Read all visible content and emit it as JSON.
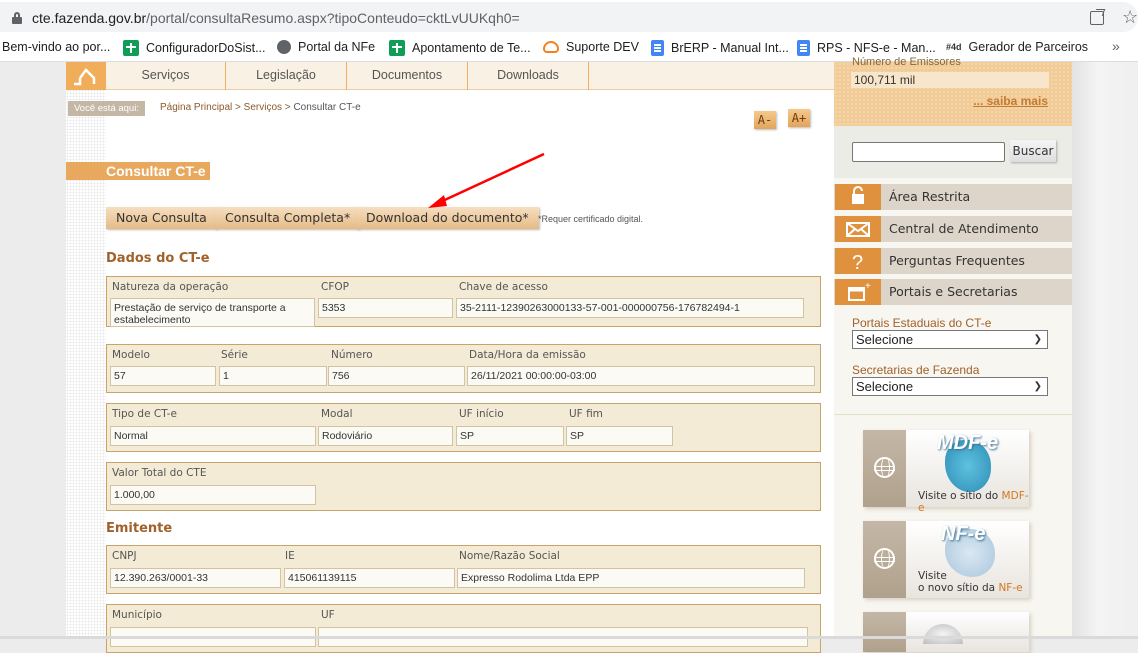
{
  "browser": {
    "url_host": "cte.fazenda.gov.br",
    "url_path": "/portal/consultaResumo.aspx?tipoConteudo=cktLvUUKqh0=",
    "bookmarks": [
      {
        "label": "Bem-vindo ao por...",
        "icon": "none"
      },
      {
        "label": "ConfiguradorDoSist...",
        "icon": "green-plus-icon"
      },
      {
        "label": "Portal da NFe",
        "icon": "globe-icon"
      },
      {
        "label": "Apontamento de Te...",
        "icon": "green-plus-icon"
      },
      {
        "label": "Suporte DEV",
        "icon": "cloud-icon"
      },
      {
        "label": "BrERP - Manual Int...",
        "icon": "doc-icon"
      },
      {
        "label": "RPS - NFS-e - Man...",
        "icon": "doc-icon"
      },
      {
        "label": "Gerador de Parceiros",
        "icon": "4d-icon",
        "icon_text": "#4d"
      }
    ],
    "more_bookmarks": "»"
  },
  "nav": {
    "items": [
      "Serviços",
      "Legislação",
      "Documentos",
      "Downloads"
    ]
  },
  "breadcrumb": {
    "label": "Você está aqui:",
    "items": [
      "Página Principal",
      "Serviços",
      "Consultar CT-e"
    ],
    "separator": " > "
  },
  "font_controls": {
    "decrease": "A-",
    "increase": "A+"
  },
  "page_title": "Consultar CT-e",
  "actions": {
    "new_query": "Nova Consulta",
    "full_query": "Consulta Completa*",
    "download": "Download do documento*",
    "note": "*Requer certificado digital."
  },
  "dados": {
    "heading": "Dados do CT-e",
    "row1": {
      "natureza_label": "Natureza da operação",
      "natureza_value": "Prestação de serviço de transporte a estabelecimento",
      "cfop_label": "CFOP",
      "cfop_value": "5353",
      "chave_label": "Chave de acesso",
      "chave_value": "35-2111-12390263000133-57-001-000000756-176782494-1"
    },
    "row2": {
      "modelo_label": "Modelo",
      "modelo_value": "57",
      "serie_label": "Série",
      "serie_value": "1",
      "numero_label": "Número",
      "numero_value": "756",
      "data_label": "Data/Hora da emissão",
      "data_value": "26/11/2021 00:00:00-03:00"
    },
    "row3": {
      "tipo_label": "Tipo de CT-e",
      "tipo_value": "Normal",
      "modal_label": "Modal",
      "modal_value": "Rodoviário",
      "ufini_label": "UF início",
      "ufini_value": "SP",
      "uffim_label": "UF fim",
      "uffim_value": "SP"
    },
    "row4": {
      "valor_label": "Valor Total do CTE",
      "valor_value": "1.000,00"
    }
  },
  "emitente": {
    "heading": "Emitente",
    "row1": {
      "cnpj_label": "CNPJ",
      "cnpj_value": "12.390.263/0001-33",
      "ie_label": "IE",
      "ie_value": "415061139115",
      "nome_label": "Nome/Razão Social",
      "nome_value": "Expresso Rodolima Ltda EPP"
    },
    "row2": {
      "municipio_label": "Município",
      "municipio_value": "",
      "uf_label": "UF",
      "uf_value": ""
    }
  },
  "sidebar": {
    "emitters_label": "Número de Emissores",
    "emitters_value": "100,711 mil",
    "saiba_mais": "... saiba mais",
    "search_placeholder": "",
    "search_button": "Buscar",
    "menu": [
      {
        "label": "Área Restrita",
        "icon": "lock-icon"
      },
      {
        "label": "Central de Atendimento",
        "icon": "envelope-icon"
      },
      {
        "label": "Perguntas Frequentes",
        "icon": "question-icon"
      },
      {
        "label": "Portais e Secretarias",
        "icon": "window-plus-icon"
      }
    ],
    "portais_label": "Portais Estaduais do CT-e",
    "portais_selected": "Selecione",
    "secretarias_label": "Secretarias de Fazenda",
    "secretarias_selected": "Selecione",
    "promos": [
      {
        "logo": "MDF-e",
        "text_pre": "Visite o sítio do ",
        "text_hl": "MDF-e"
      },
      {
        "logo": "NF-e",
        "text_pre": "Visite",
        "text_line2": "o novo sítio da ",
        "text_hl": "NF-e"
      }
    ]
  },
  "annotation": {
    "color": "#ff0000"
  }
}
